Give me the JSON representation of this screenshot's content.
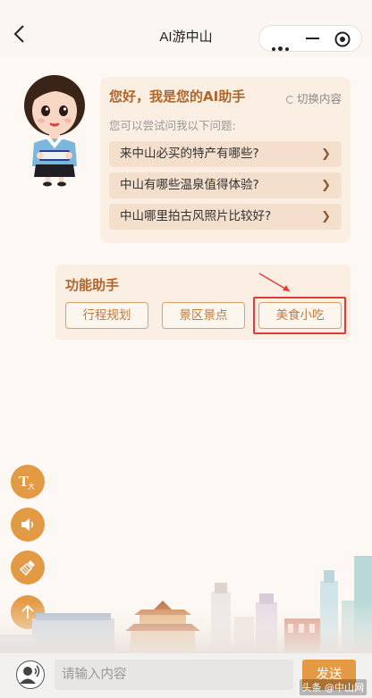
{
  "header": {
    "title": "AI游中山"
  },
  "greeting": {
    "title": "您好，我是您的AI助手",
    "switch_label": "切换内容",
    "hint": "您可以尝试问我以下问题:",
    "questions": [
      "来中山必买的特产有哪些?",
      "中山有哪些温泉值得体验?",
      "中山哪里拍古风照片比较好?"
    ]
  },
  "function_panel": {
    "title": "功能助手",
    "buttons": [
      "行程规划",
      "景区景点",
      "美食小吃"
    ]
  },
  "input_bar": {
    "placeholder": "请输入内容",
    "send_label": "发送"
  },
  "watermark": "头条 @中山网",
  "colors": {
    "accent": "#e39a44",
    "card_bg": "#fbeee2",
    "title_brown": "#b0652a",
    "highlight_red": "#e63a3a"
  }
}
